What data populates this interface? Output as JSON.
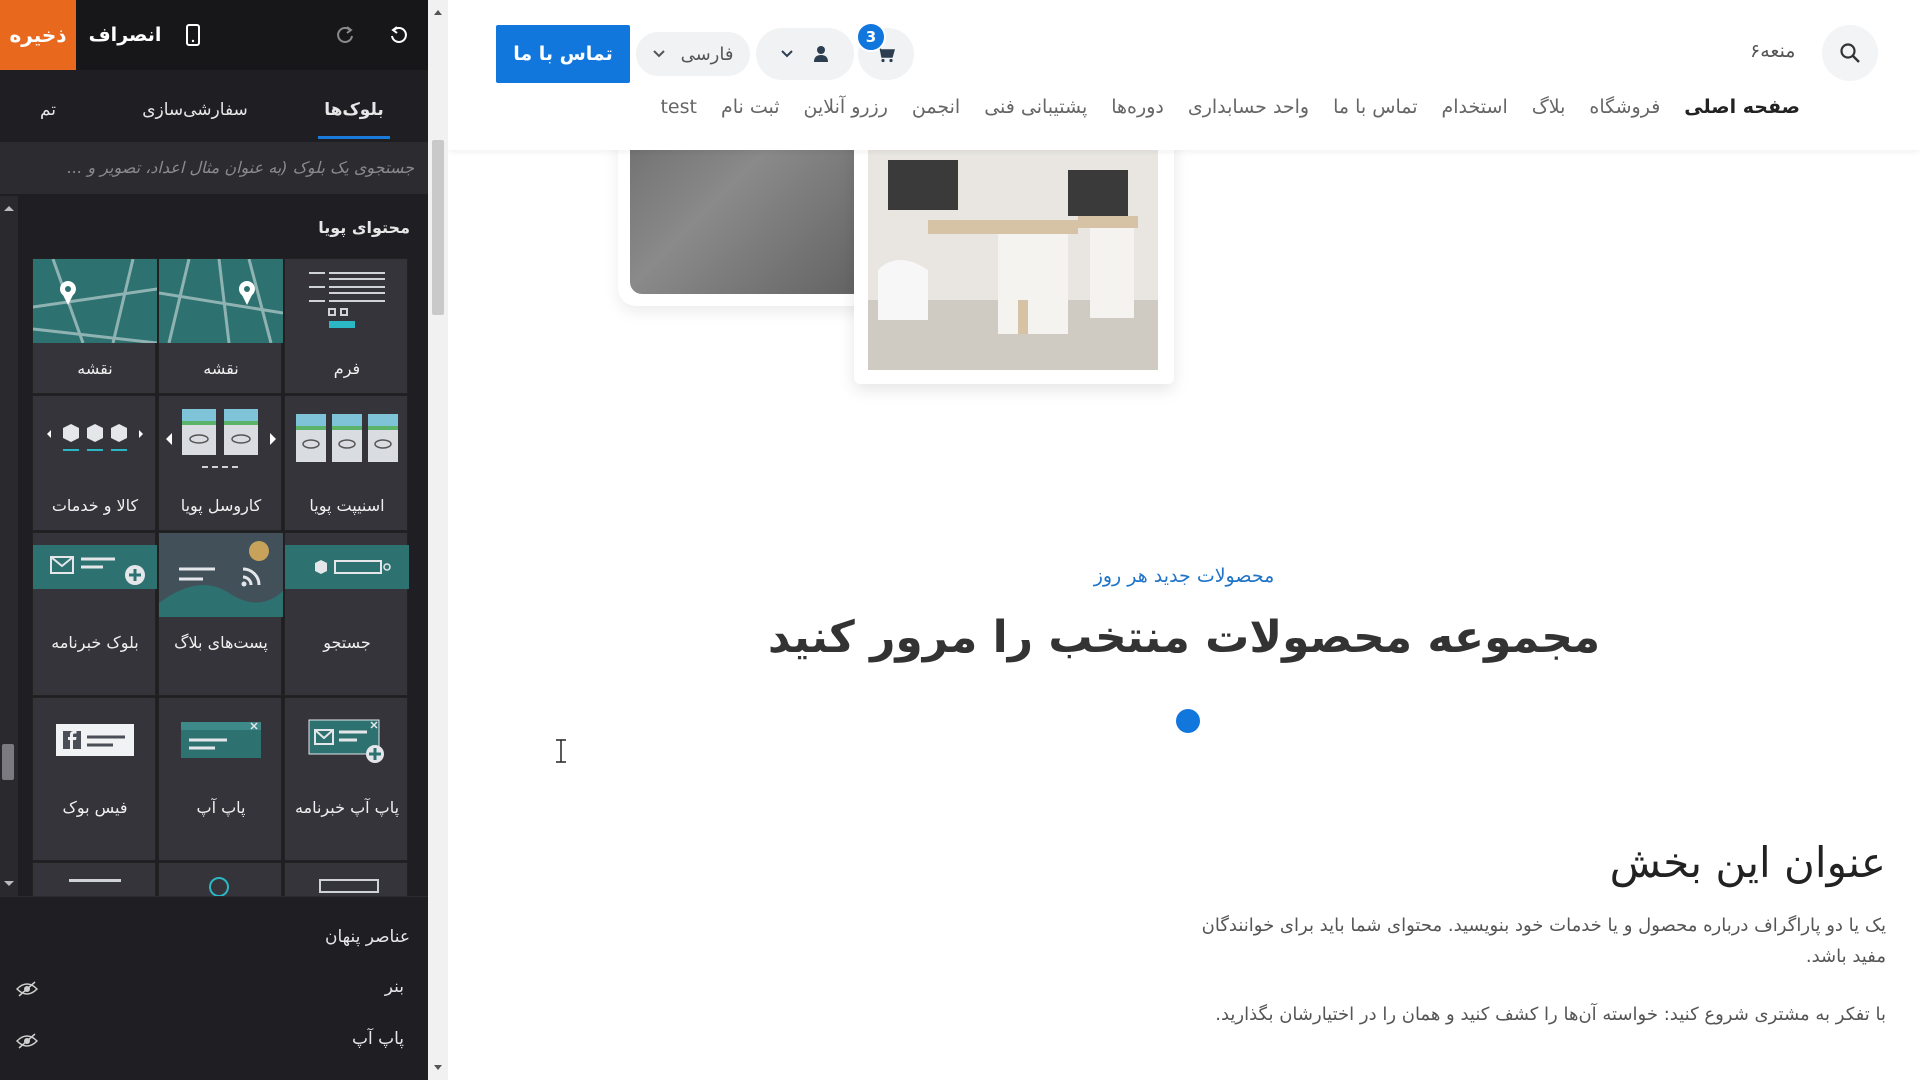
{
  "editor": {
    "topbar": {
      "save_label": "ذخیره",
      "cancel_label": "انصراف",
      "accent_color": "#e8681e"
    },
    "tabs": [
      {
        "label": "بلوک‌ها",
        "active": true
      },
      {
        "label": "سفارشی‌سازی",
        "active": false
      },
      {
        "label": "تم",
        "active": false
      }
    ],
    "search_placeholder": "جستجوی یک بلوک (به عنوان مثال اعداد، تصویر و ...",
    "section_title": "محتوای پویا",
    "blocks": [
      {
        "label": "فرم",
        "icon": "form-icon"
      },
      {
        "label": "نقشه",
        "icon": "map-icon"
      },
      {
        "label": "نقشه",
        "icon": "map-icon"
      },
      {
        "label": "اسنیپت پویا",
        "icon": "dynamic-snippet-icon"
      },
      {
        "label": "کاروسل پویا",
        "icon": "dynamic-carousel-icon"
      },
      {
        "label": "کالا و خدمات",
        "icon": "products-icon"
      },
      {
        "label": "جستجو",
        "icon": "search-block-icon"
      },
      {
        "label": "پست‌های بلاگ",
        "icon": "blog-posts-icon"
      },
      {
        "label": "بلوک خبرنامه",
        "icon": "newsletter-block-icon"
      },
      {
        "label": "پاپ آپ خبرنامه",
        "icon": "newsletter-popup-icon"
      },
      {
        "label": "پاپ آپ",
        "icon": "popup-icon"
      },
      {
        "label": "فیس بوک",
        "icon": "facebook-icon"
      }
    ],
    "hidden_elements": {
      "title": "عناصر پنهان",
      "items": [
        "بنر",
        "پاپ آپ"
      ]
    }
  },
  "site": {
    "logo_text": "منعه۶",
    "contact_button": "تماس با ما",
    "language": "فارسی",
    "cart_count": "3",
    "brand_color": "#1177dd",
    "nav": [
      "صفحه اصلی",
      "فروشگاه",
      "بلاگ",
      "استخدام",
      "تماس با ما",
      "واحد حسابداری",
      "دوره‌ها",
      "پشتیبانی فنی",
      "انجمن",
      "رزرو آنلاین",
      "ثبت نام",
      "test"
    ],
    "subheading": "محصولات جدید هر روز",
    "heading": "مجموعه محصولات منتخب را مرور کنید",
    "section_title": "عنوان این بخش",
    "paragraph_1": "یک یا دو پاراگراف درباره محصول و یا خدمات خود بنویسید. محتوای شما باید برای خوانندگان مفید باشد.",
    "paragraph_2": "با تفکر به مشتری شروع کنید: خواسته آن‌ها را کشف کنید و همان را در اختیارشان بگذارید."
  }
}
